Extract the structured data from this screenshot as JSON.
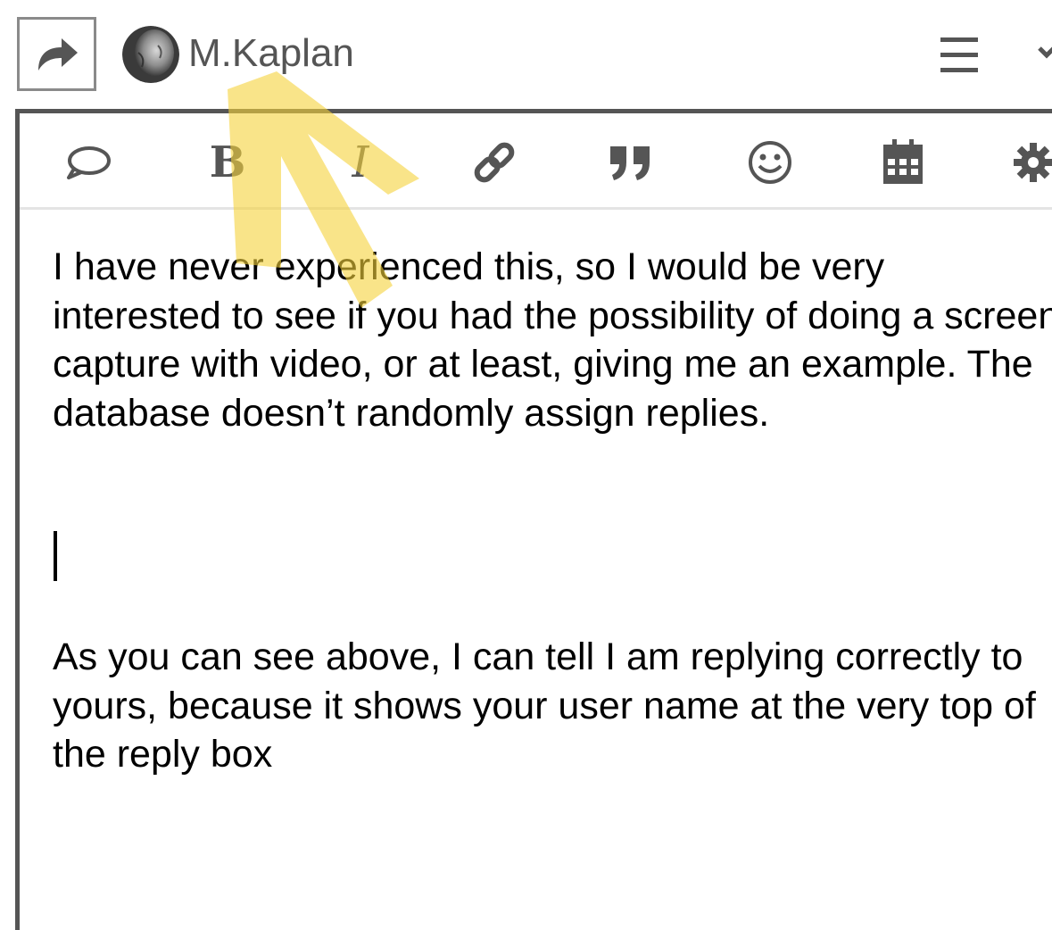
{
  "header": {
    "reply_icon": "reply-arrow-icon",
    "username": "M.Kaplan",
    "menu_icon": "hamburger-menu-icon",
    "overflow_icon": "chevron-down-icon"
  },
  "toolbar": {
    "items": [
      {
        "name": "quote-bubble-icon"
      },
      {
        "name": "bold-icon",
        "label": "B"
      },
      {
        "name": "italic-icon",
        "label": "I"
      },
      {
        "name": "link-icon"
      },
      {
        "name": "blockquote-icon"
      },
      {
        "name": "emoji-icon"
      },
      {
        "name": "calendar-icon"
      },
      {
        "name": "gear-icon"
      }
    ]
  },
  "editor": {
    "paragraph_1": "I have never experienced this, so I would be very interested to see if you had the possibility of doing a screen capture with video, or at least, giving me an example. The database doesn’t randomly assign replies.",
    "paragraph_2": "As you can see above, I can tell I am replying correctly to yours, because it shows your user name at the very top of the reply box"
  },
  "colors": {
    "annotation_arrow": "#f5d23a",
    "icon_gray": "#555555",
    "border_gray": "#8a8a8a"
  }
}
